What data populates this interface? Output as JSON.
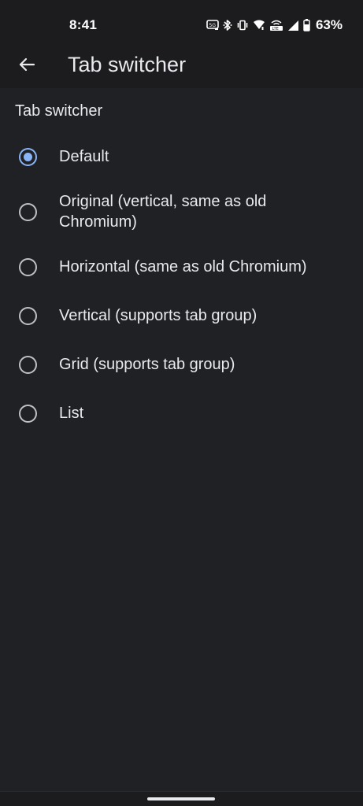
{
  "status_bar": {
    "time": "8:41",
    "battery_percent": "63%",
    "icons": [
      "data-saver-icon",
      "bluetooth-icon",
      "vibrate-icon",
      "wifi-icon",
      "volte-icon",
      "cell-signal-icon",
      "battery-icon"
    ]
  },
  "app_bar": {
    "title": "Tab switcher",
    "back_icon": "arrow-back-icon"
  },
  "section": {
    "title": "Tab switcher"
  },
  "options": [
    {
      "label": "Default",
      "checked": true
    },
    {
      "label": "Original (vertical, same as old Chromium)",
      "checked": false
    },
    {
      "label": "Horizontal (same as old Chromium)",
      "checked": false
    },
    {
      "label": "Vertical (supports tab group)",
      "checked": false
    },
    {
      "label": "Grid (supports tab group)",
      "checked": false
    },
    {
      "label": "List",
      "checked": false
    }
  ],
  "colors": {
    "background": "#202124",
    "bar": "#1c1c1e",
    "accent": "#8ab4f8",
    "text": "#e8eaed"
  }
}
